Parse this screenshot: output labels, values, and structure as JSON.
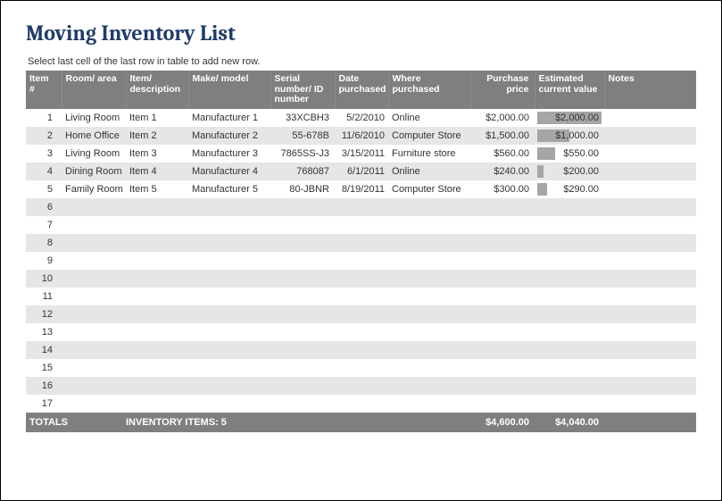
{
  "title": "Moving Inventory List",
  "instruction": "Select last cell of the last row in table to add new row.",
  "columns": {
    "item_no": "Item #",
    "room": "Room/ area",
    "desc": "Item/ description",
    "make": "Make/ model",
    "serial": "Serial number/ ID number",
    "date": "Date purchased",
    "where": "Where purchased",
    "price": "Purchase price",
    "value": "Estimated current value",
    "notes": "Notes"
  },
  "rows": [
    {
      "n": "1",
      "room": "Living Room",
      "desc": "Item 1",
      "make": "Manufacturer 1",
      "serial": "33XCBH3",
      "date": "5/2/2010",
      "where": "Online",
      "price": "$2,000.00",
      "value": "$2,000.00",
      "bar": 100
    },
    {
      "n": "2",
      "room": "Home Office",
      "desc": "Item 2",
      "make": "Manufacturer 2",
      "serial": "55-678B",
      "date": "11/6/2010",
      "where": "Computer Store",
      "price": "$1,500.00",
      "value": "$1,000.00",
      "bar": 50
    },
    {
      "n": "3",
      "room": "Living Room",
      "desc": "Item 3",
      "make": "Manufacturer 3",
      "serial": "7865SS-J3",
      "date": "3/15/2011",
      "where": "Furniture store",
      "price": "$560.00",
      "value": "$550.00",
      "bar": 28
    },
    {
      "n": "4",
      "room": "Dining Room",
      "desc": "Item 4",
      "make": "Manufacturer 4",
      "serial": "768087",
      "date": "6/1/2011",
      "where": "Online",
      "price": "$240.00",
      "value": "$200.00",
      "bar": 10
    },
    {
      "n": "5",
      "room": "Family Room",
      "desc": "Item 5",
      "make": "Manufacturer 5",
      "serial": "80-JBNR",
      "date": "8/19/2011",
      "where": "Computer Store",
      "price": "$300.00",
      "value": "$290.00",
      "bar": 15
    }
  ],
  "empty_rows": [
    "6",
    "7",
    "8",
    "9",
    "10",
    "11",
    "12",
    "13",
    "14",
    "15",
    "16",
    "17"
  ],
  "totals": {
    "label": "TOTALS",
    "count_label": "INVENTORY ITEMS: 5",
    "price": "$4,600.00",
    "value": "$4,040.00"
  }
}
